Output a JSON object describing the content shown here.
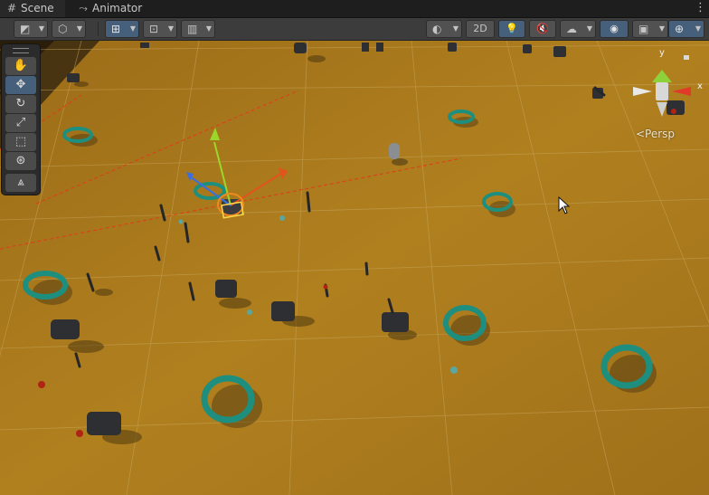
{
  "tabs": [
    {
      "label": "Scene",
      "icon": "grid-icon",
      "active": true
    },
    {
      "label": "Animator",
      "icon": "animator-icon",
      "active": false
    }
  ],
  "tab_menu_icon": "kebab-menu-icon",
  "toolbar": {
    "two_d_label": "2D"
  },
  "tools": [
    {
      "name": "hand-tool",
      "icon": "hand-icon",
      "active": false
    },
    {
      "name": "move-tool",
      "icon": "move-icon",
      "active": true
    },
    {
      "name": "rotate-tool",
      "icon": "rotate-icon",
      "active": false
    },
    {
      "name": "scale-tool",
      "icon": "scale-icon",
      "active": false
    },
    {
      "name": "rect-tool",
      "icon": "rect-icon",
      "active": false
    },
    {
      "name": "transform-tool",
      "icon": "transform-icon",
      "active": false
    },
    {
      "name": "custom-tool",
      "icon": "custom-tool-icon",
      "active": false
    }
  ],
  "gizmo": {
    "axis_y": "y",
    "axis_x": "x",
    "projection_label": "<Persp"
  },
  "colors": {
    "ground": "#a8761e",
    "selection_accent": "#46607c",
    "ring": "#1e8f7e"
  }
}
